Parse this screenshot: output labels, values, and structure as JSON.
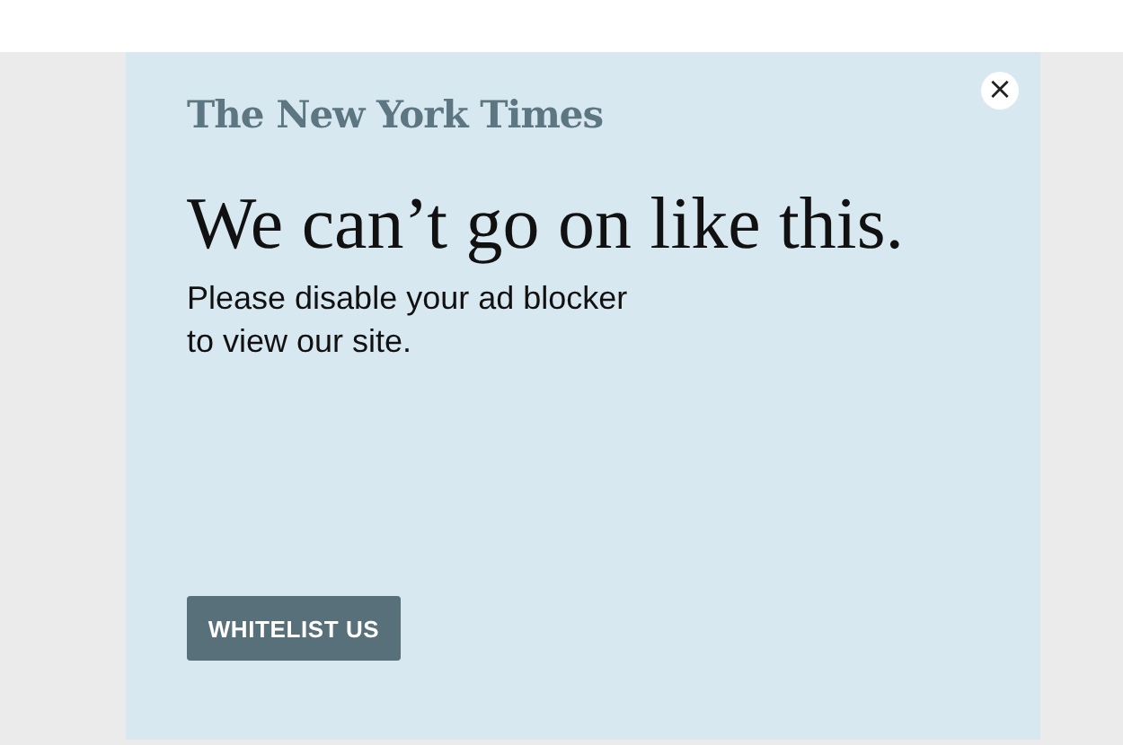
{
  "modal": {
    "logo": "The New York Times",
    "close": "×",
    "headline": "We can’t go on like this.",
    "message_lines": [
      "Please disable your ad blocker",
      "to view our site."
    ],
    "button": "WHITELIST US"
  }
}
